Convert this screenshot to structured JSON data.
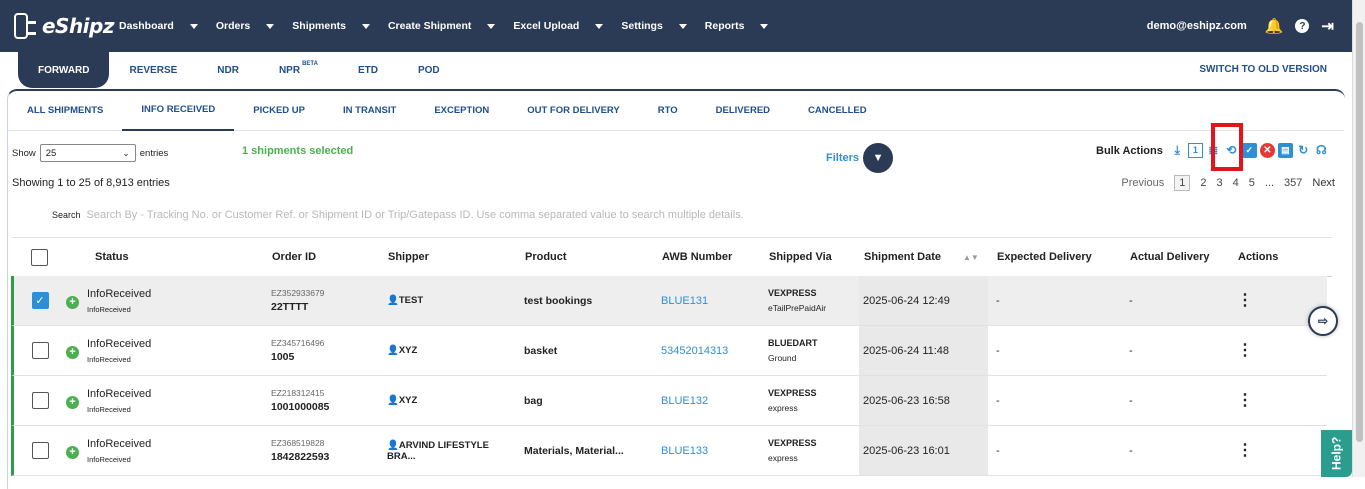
{
  "app": {
    "name": "eShipz",
    "user": "demo@eshipz.com"
  },
  "nav": [
    "Dashboard",
    "Orders",
    "Shipments",
    "Create Shipment",
    "Excel Upload",
    "Settings",
    "Reports"
  ],
  "mode_tabs": [
    {
      "label": "FORWARD",
      "active": true
    },
    {
      "label": "REVERSE"
    },
    {
      "label": "NDR"
    },
    {
      "label": "NPR",
      "badge": "BETA"
    },
    {
      "label": "ETD"
    },
    {
      "label": "POD"
    }
  ],
  "switch_label": "SWITCH TO OLD VERSION",
  "status_tabs": [
    "ALL SHIPMENTS",
    "INFO RECEIVED",
    "PICKED UP",
    "IN TRANSIT",
    "EXCEPTION",
    "OUT FOR DELIVERY",
    "RTO",
    "DELIVERED",
    "CANCELLED"
  ],
  "toolbar": {
    "show_label": "Show",
    "entries_value": "25",
    "entries_label": "entries",
    "selected_text": "1 shipments selected",
    "filters_label": "Filters",
    "bulk_label": "Bulk Actions",
    "showing_text": "Showing 1 to 25 of 8,913 entries",
    "search_label": "Search",
    "search_placeholder": "Search By - Tracking No. or Customer Ref. or Shipment ID or Trip/Gatepass ID. Use comma separated value to search multiple details."
  },
  "pagination": {
    "prev": "Previous",
    "pages": [
      "1",
      "2",
      "3",
      "4",
      "5",
      "...",
      "357"
    ],
    "next": "Next"
  },
  "columns": [
    "Status",
    "Order ID",
    "Shipper",
    "Product",
    "AWB Number",
    "Shipped Via",
    "Shipment Date",
    "Expected Delivery",
    "Actual Delivery",
    "Actions"
  ],
  "rows": [
    {
      "checked": true,
      "status": "InfoReceived",
      "status_sub": "InfoReceived",
      "order_ref": "EZ352933679",
      "order_id": "22TTTT",
      "shipper": "TEST",
      "product": "test bookings",
      "awb": "BLUE131",
      "via": "VEXPRESS",
      "via_sub": "eTailPrePaidAir",
      "date": "2025-06-24 12:49",
      "expected": "-",
      "actual": "-"
    },
    {
      "checked": false,
      "status": "InfoReceived",
      "status_sub": "InfoReceived",
      "order_ref": "EZ345716496",
      "order_id": "1005",
      "shipper": "XYZ",
      "product": "basket",
      "awb": "53452014313",
      "via": "BLUEDART",
      "via_sub": "Ground",
      "date": "2025-06-24 11:48",
      "expected": "-",
      "actual": "-"
    },
    {
      "checked": false,
      "status": "InfoReceived",
      "status_sub": "InfoReceived",
      "order_ref": "EZ218312415",
      "order_id": "1001000085",
      "shipper": "XYZ",
      "product": "bag",
      "awb": "BLUE132",
      "via": "VEXPRESS",
      "via_sub": "express",
      "date": "2025-06-23 16:58",
      "expected": "-",
      "actual": "-"
    },
    {
      "checked": false,
      "status": "InfoReceived",
      "status_sub": "InfoReceived",
      "order_ref": "EZ368519828",
      "order_id": "1842822593",
      "shipper": "ARVIND LIFESTYLE BRA...",
      "product": "Materials, Material...",
      "awb": "BLUE133",
      "via": "VEXPRESS",
      "via_sub": "express",
      "date": "2025-06-23 16:01",
      "expected": "-",
      "actual": "-"
    }
  ],
  "help_label": "Help?"
}
